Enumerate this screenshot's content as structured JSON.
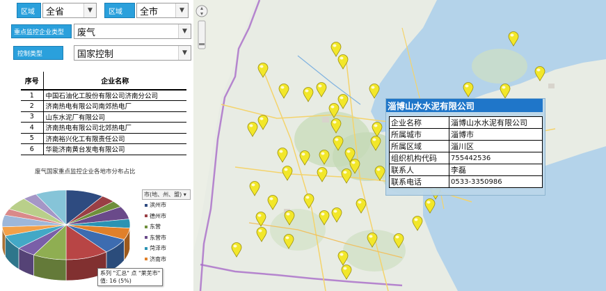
{
  "filters": {
    "region_label_1": "区域",
    "region_value_1": "全省",
    "region_label_2": "区域",
    "region_value_2": "全市",
    "type_label": "重点监控企业类型",
    "type_value": "废气",
    "control_label": "控制类型",
    "control_value": "国家控制"
  },
  "table": {
    "headers": [
      "序号",
      "企业名称"
    ],
    "rows": [
      {
        "no": "1",
        "name": "中国石油化工股份有限公司济南分公司"
      },
      {
        "no": "2",
        "name": "济南热电有限公司南郊热电厂"
      },
      {
        "no": "3",
        "name": "山东水泥厂有限公司"
      },
      {
        "no": "4",
        "name": "济南热电有限公司北郊热电厂"
      },
      {
        "no": "5",
        "name": "济南裕兴化工有限责任公司"
      },
      {
        "no": "6",
        "name": "华能济南黄台发电有限公司"
      }
    ]
  },
  "chart_data": {
    "type": "pie",
    "title": "废气国家重点监控企业各地市分布占比",
    "legend_header": "市(地、州、盟)",
    "categories": [
      "滨州市",
      "德州市",
      "东营",
      "东营市",
      "菏泽市",
      "济南市"
    ],
    "values": [
      16,
      6,
      5,
      10,
      7,
      9,
      12,
      18,
      14,
      8,
      11,
      7,
      9,
      5,
      10,
      6,
      13
    ],
    "colors": [
      "#2e4b80",
      "#9a3f45",
      "#6f8f3b",
      "#6a4a8a",
      "#2a93b3",
      "#e0802a",
      "#3d6cb0",
      "#b84545",
      "#8fae52",
      "#7a5fa8",
      "#43a8c6",
      "#f2a04a",
      "#9db7da",
      "#d9898a",
      "#b9cf8a",
      "#a596c6",
      "#86c4d8"
    ],
    "tooltip_line1": "系列 \"汇总\" 点 \"莱芜市\"",
    "tooltip_line2": "值: 16 (5%)"
  },
  "map": {
    "labels": [],
    "marker_color": "#f2e72a"
  },
  "info_window": {
    "title": "淄博山水水泥有限公司",
    "rows": [
      {
        "k": "企业名称",
        "v": "淄博山水水泥有限公司"
      },
      {
        "k": "所属城市",
        "v": "淄博市"
      },
      {
        "k": "所属区域",
        "v": "淄川区"
      },
      {
        "k": "组织机构代码",
        "v": "755442536"
      },
      {
        "k": "联系人",
        "v": "李磊"
      },
      {
        "k": "联系电话",
        "v": "0533-3350986"
      }
    ]
  }
}
